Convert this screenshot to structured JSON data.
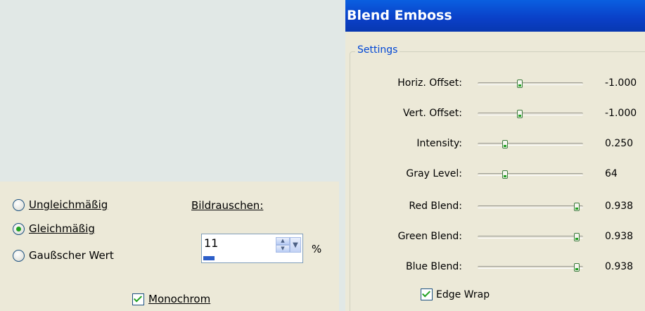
{
  "noise_panel": {
    "options": [
      {
        "label": "Ungleichmäßig",
        "checked": false
      },
      {
        "label": "Gleichmäßig",
        "checked": true
      },
      {
        "label": "Gaußscher Wert",
        "checked": false
      }
    ],
    "noise_label": "Bildrauschen:",
    "noise_value": "11",
    "noise_level_fraction": 0.11,
    "percent_label": "%",
    "monochrome_label": "Monochrom",
    "monochrome_checked": true
  },
  "dialog": {
    "title": "Blend Emboss",
    "settings_legend": "Settings",
    "sliders": [
      {
        "label": "Horiz. Offset:",
        "value": "-1.000",
        "position": 0.4
      },
      {
        "label": "Vert. Offset:",
        "value": "-1.000",
        "position": 0.4
      },
      {
        "label": "Intensity:",
        "value": "0.250",
        "position": 0.26
      },
      {
        "label": "Gray Level:",
        "value": "64",
        "position": 0.26
      },
      {
        "label": "Red Blend:",
        "value": "0.938",
        "position": 0.94
      },
      {
        "label": "Green Blend:",
        "value": "0.938",
        "position": 0.94
      },
      {
        "label": "Blue Blend:",
        "value": "0.938",
        "position": 0.94
      }
    ],
    "edge_wrap_label": "Edge Wrap",
    "edge_wrap_checked": true
  },
  "colors": {
    "titlebar": "#0a46d0",
    "panel": "#ece9d8",
    "accent_green": "#21a121"
  }
}
